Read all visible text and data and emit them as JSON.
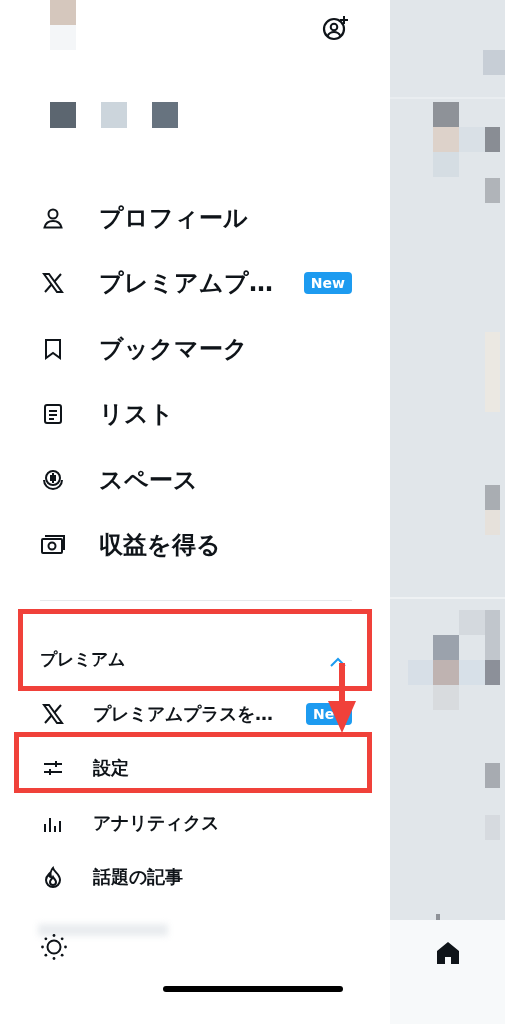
{
  "menu": [
    {
      "label": "プロフィール"
    },
    {
      "label": "プレミアムプ…",
      "badge": "New"
    },
    {
      "label": "ブックマーク"
    },
    {
      "label": "リスト"
    },
    {
      "label": "スペース"
    },
    {
      "label": "収益を得る"
    }
  ],
  "section": {
    "title": "プレミアム",
    "expanded": true,
    "items": [
      {
        "label": "プレミアムプラスを…",
        "badge": "Ne"
      },
      {
        "label": "設定"
      },
      {
        "label": "アナリティクス"
      },
      {
        "label": "話題の記事"
      }
    ]
  },
  "annotations": [
    {
      "kind": "box"
    },
    {
      "kind": "arrow"
    },
    {
      "kind": "box"
    }
  ]
}
